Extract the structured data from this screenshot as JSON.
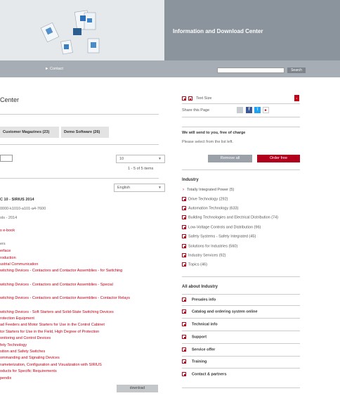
{
  "header": {
    "title": "Information and Download Center"
  },
  "nav": {
    "contact": "Contact",
    "search_button": "Search"
  },
  "page": {
    "title": "Center",
    "tabs": [
      "Customer Magazines (23)",
      "Demo Software (26)"
    ],
    "page_size": "10",
    "items_count": "1 - 5 of 5 items",
    "language": "English",
    "product_title": "C 10 - SIRIUS 2014",
    "product_number": "0000-k1010-a101-a4-7600",
    "product_year": "ols - 2014",
    "ebook_link": "s e-book",
    "toc_heading": "ers",
    "toc": [
      "erface",
      "roduction",
      "ustrial Communication",
      "witching Devices - Contactors and Contactor Assemblies - for Switching",
      "witching Devices - Contactors and Contactor Assemblies - Special",
      "witching Devices - Contactors and Contactor Assemblies - Contactor Relays",
      "witching Devices - Soft Starters and Solid-State Switching Devices",
      "rotection Equipment",
      "ad Feeders and Motor Starters for Use in the Control Cabinet",
      "tor Starters for Use in the Field, High Degree of Protection",
      "onitoring and Control Devices",
      "fety Technology",
      "sition and Safety Switches",
      "ommanding and Signaling Devices",
      "rameterization, Configuration and Visualization with SIRIUS",
      "oducts for Specific Requirements",
      "pendix"
    ],
    "download_button": "download"
  },
  "sidebar": {
    "text_size": "Text Size",
    "share": "Share this Page",
    "free_title": "We will send to you, free of charge",
    "free_sub": "Please select from the list left.",
    "remove_all": "Remove all",
    "order_free": "Order free",
    "industry_title": "Industry",
    "industry_items": [
      "Totally Integrated Power (5)",
      "Drive Technology (292)",
      "Automation Technology (633)",
      "Building Technologies and Electrical Distribution (74)",
      "Low-Voltage Controls and Distribution (96)",
      "Safety Systems - Safety Integrated (45)",
      "Solutions for Industries (560)",
      "Industry Services (92)",
      "Topics (46)"
    ],
    "about_title": "All about Industry",
    "about_items": [
      "Presales info",
      "Catalog and ordering system online",
      "Technical info",
      "Support",
      "Service offer",
      "Training",
      "Contact & partners"
    ]
  },
  "colors": {
    "accent": "#c00017",
    "header_grey": "#8b949d",
    "nav_grey": "#a6adb4"
  }
}
